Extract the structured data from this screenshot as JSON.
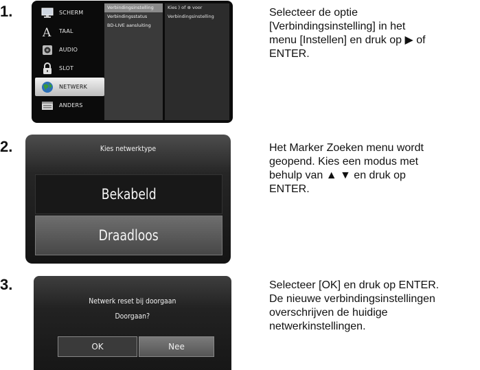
{
  "steps": [
    {
      "number": "1.",
      "lines": [
        "Selecteer de optie",
        "[Verbindingsinstelling] in het",
        "menu [Instellen] en druk op ▶ of",
        "ENTER."
      ]
    },
    {
      "number": "2.",
      "lines": [
        "Het Marker Zoeken menu wordt",
        "geopend. Kies een modus met",
        "behulp van ▲ ▼ en druk op",
        "ENTER."
      ]
    },
    {
      "number": "3.",
      "lines": [
        "Selecteer [OK] en druk op ENTER.",
        "De nieuwe verbindingsinstellingen",
        "overschrijven de huidige",
        "netwerkinstellingen."
      ]
    }
  ],
  "screen1": {
    "menu": [
      {
        "label": "SCHERM",
        "icon": "monitor-icon"
      },
      {
        "label": "TAAL",
        "icon": "font-icon"
      },
      {
        "label": "AUDIO",
        "icon": "speaker-icon"
      },
      {
        "label": "SLOT",
        "icon": "padlock-icon"
      },
      {
        "label": "NETWERK",
        "icon": "globe-icon",
        "selected": true
      },
      {
        "label": "ANDERS",
        "icon": "other-icon"
      }
    ],
    "submenu": [
      "Verbindingsinstelling",
      "Verbindingsstatus",
      "BD-LIVE aansluiting"
    ],
    "hint": [
      "Kies ) of ⊛ voor",
      "Verbindingsinstelling"
    ]
  },
  "screen2": {
    "title": "Kies netwerktype",
    "options": [
      "Bekabeld",
      "Draadloos"
    ],
    "selected": "Draadloos"
  },
  "screen3": {
    "line1": "Netwerk reset bij doorgaan",
    "line2": "Doorgaan?",
    "ok_label": "OK",
    "no_label": "Nee"
  }
}
